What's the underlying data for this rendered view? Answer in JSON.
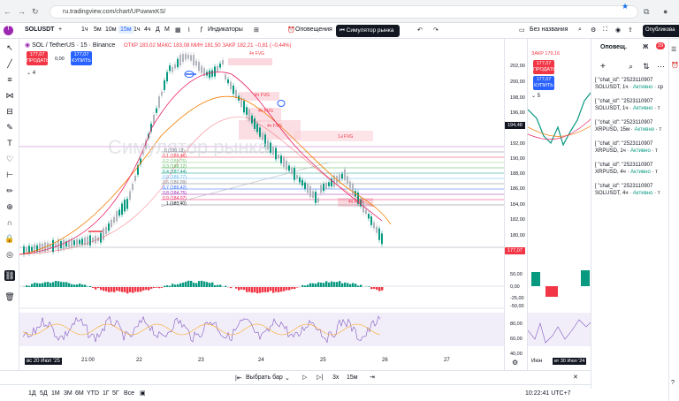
{
  "browser": {
    "url": "ru.tradingview.com/chart/UPuwwxKS/"
  },
  "toolbar": {
    "symbol": "SOLUSDT",
    "intervals": [
      "1ч",
      "5м",
      "10м",
      "15м",
      "1ч",
      "4ч",
      "Д",
      "М"
    ],
    "active_interval": "15м",
    "indicators": "Индикаторы",
    "alerts": "Оповещения",
    "simulator": "Симулятор рынка",
    "layout_name": "Без названия",
    "publish": "Опубликова"
  },
  "legend": {
    "title": "SOL / TetherUS · 15 · Binance",
    "open": "ОТКР 183,02",
    "high": "МАКС 183,08",
    "low": "МИН 181,50",
    "close": "ЗАКР 182,21",
    "change": "−0,81 (−0,44%)",
    "sell_price": "177,07",
    "sell_label": "ПРОДАТЬ",
    "spread": "0,00",
    "buy_price": "177,07",
    "buy_label": "КУПИТЬ",
    "count": "4"
  },
  "watermark": "Симулятор рынка",
  "fib_levels": [
    "0 (190,13)",
    "0,1 (189,46)",
    "0,2 (188,75)",
    "0,3 (188,12)",
    "0,4 (187,44)",
    "0,5 (186,77)",
    "0,6 (186,09)",
    "0,7 (185,42)",
    "0,8 (184,75)",
    "0,9 (184,07)",
    "1 (183,40)"
  ],
  "fvg_labels": [
    "4ч FVG",
    "4ч FVG",
    "4ч FVG",
    "4ч FVG",
    "1Ⅎ FVG",
    "4ч FVG"
  ],
  "price_axis": [
    "202,00",
    "200,00",
    "198,00",
    "196,00",
    "194,48",
    "192,00",
    "190,00",
    "188,00",
    "186,00",
    "184,00",
    "182,00",
    "180,00",
    "177,07",
    "50,00",
    "0,00",
    "-25,00",
    "-50,00",
    "80,00",
    "60,00",
    "40,00"
  ],
  "current_price": "177,07",
  "time_axis": [
    "вс 20 Июл '25",
    "21:00",
    "22",
    "23",
    "24",
    "25",
    "26",
    "27"
  ],
  "mini": {
    "header": "ЗАКР 179,16",
    "sell": "177,07",
    "sell_label": "ПРОДАТЬ",
    "buy": "177,07",
    "buy_label": "КУПИТЬ",
    "count": "5",
    "time_left": "Июн",
    "time_right": "вт 30 Июл '24"
  },
  "alerts_panel": {
    "tab1": "Оповещ.",
    "tab2": "Ж",
    "badge": "29",
    "items": [
      {
        "title": "[ \"chat_id\": \"2523110907",
        "sym": "SOLUSDT, 1ч",
        "status": "Активно",
        "extra": "· ср"
      },
      {
        "title": "[ \"chat_id\": \"2523110907",
        "sym": "SOLUSDT, 1ч",
        "status": "Активно",
        "extra": "· т"
      },
      {
        "title": "[ \"chat_id\": \"2523110907",
        "sym": "XRPUSD, 15м",
        "status": "Активно",
        "extra": "· т"
      },
      {
        "title": "[ \"chat_id\": \"2523110907",
        "sym": "XRPUSD, 1ч",
        "status": "Активно",
        "extra": "· т"
      },
      {
        "title": "[ \"chat_id\": \"2523110907",
        "sym": "XRPUSD, 4ч",
        "status": "Активно",
        "extra": "· т"
      },
      {
        "title": "[ \"chat_id\": \"2523110907",
        "sym": "SOLUSDT, 4ч",
        "status": "Активно",
        "extra": "· т"
      }
    ]
  },
  "replay": {
    "select_bar": "Выбрать бар",
    "speed": "3x",
    "interval": "15м"
  },
  "ranges": [
    "1Д",
    "5Д",
    "1М",
    "3М",
    "6М",
    "YTD",
    "1Г",
    "5Г",
    "Все"
  ],
  "clock": "10:22:41 UTC+7"
}
